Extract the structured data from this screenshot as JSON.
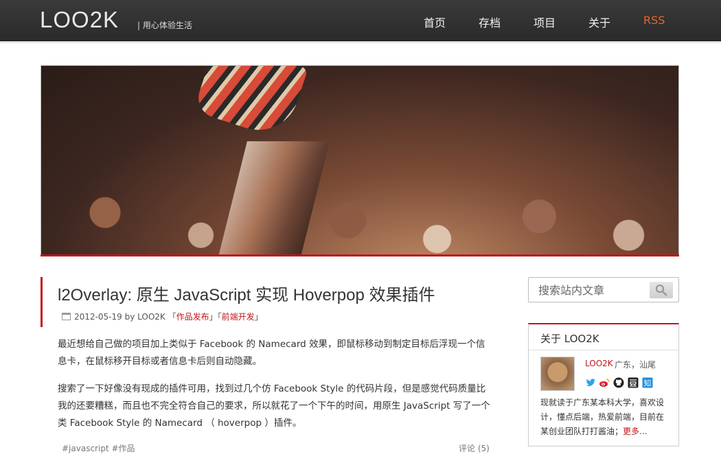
{
  "header": {
    "logo": "LOO2K",
    "tagline": "| 用心体验生活",
    "nav": [
      {
        "label": "首页"
      },
      {
        "label": "存档"
      },
      {
        "label": "项目"
      },
      {
        "label": "关于"
      },
      {
        "label": "RSS"
      }
    ]
  },
  "colors": {
    "accent": "#c0151b",
    "rss": "#e2662b",
    "header_bg": "#2f2f2f"
  },
  "article": {
    "title": "l2Overlay: 原生 JavaScript 实现 Hoverpop 效果插件",
    "date": "2012-05-19",
    "by": "by LOO2K",
    "cat1": "作品发布",
    "cat2": "前端开发",
    "para1": "最近想给自己做的项目加上类似于 Facebook 的 Namecard 效果，即鼠标移动到制定目标后浮现一个信息卡，在鼠标移开目标或者信息卡后则自动隐藏。",
    "para2": "搜索了一下好像没有现成的插件可用，找到过几个仿 Facebook Style 的代码片段，但是感觉代码质量比我的还要糟糕，而且也不完全符合自己的要求，所以就花了一个下午的时间，用原生 JavaScript 写了一个类 Facebook Style 的 Namecard （ hoverpop ）插件。",
    "tags": "#javascript  #作品",
    "comments": "评论 (5)"
  },
  "sidebar": {
    "search_placeholder": "搜索站内文章",
    "about_title": "关于 LOO2K",
    "about_name": "LOO2K",
    "about_loc": "广东，汕尾",
    "social_icons": [
      "twitter-icon",
      "weibo-icon",
      "github-icon",
      "douban-icon",
      "zhihu-icon"
    ],
    "about_text": "现就读于广东某本科大学，喜欢设计，懂点后端，热爱前端，目前在某创业团队打打酱油；",
    "about_more": "更多..."
  }
}
